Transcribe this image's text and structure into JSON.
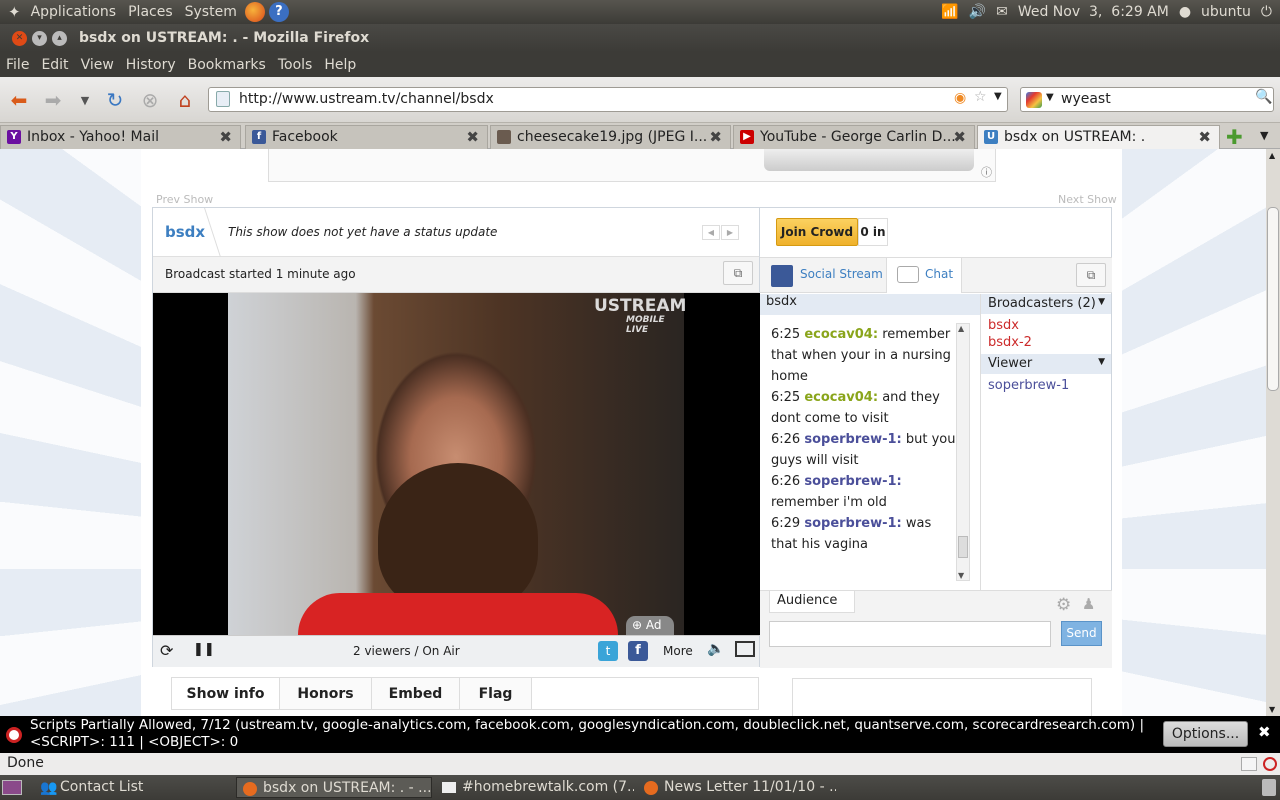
{
  "top_panel": {
    "menus": [
      "Applications",
      "Places",
      "System"
    ],
    "clock": "Wed Nov  3,  6:29 AM",
    "user": "ubuntu"
  },
  "window": {
    "title": "bsdx on USTREAM: . - Mozilla Firefox"
  },
  "menubar": [
    "File",
    "Edit",
    "View",
    "History",
    "Bookmarks",
    "Tools",
    "Help"
  ],
  "nav": {
    "url": "http://www.ustream.tv/channel/bsdx",
    "search": "wyeast"
  },
  "tabs": [
    {
      "label": "Inbox - Yahoo! Mail",
      "icon": "yahoo-icon",
      "color": "#6b0fa0",
      "glyph": "Y"
    },
    {
      "label": "Facebook",
      "icon": "facebook-icon",
      "color": "#3b5998",
      "glyph": "f"
    },
    {
      "label": "cheesecake19.jpg (JPEG I...",
      "icon": "image-icon",
      "color": "#6a5b4f",
      "glyph": ""
    },
    {
      "label": "YouTube - George Carlin D...",
      "icon": "youtube-icon",
      "color": "#cc0000",
      "glyph": "▶"
    },
    {
      "label": "bsdx on USTREAM: .",
      "icon": "ustream-icon",
      "color": "#3d7fc1",
      "glyph": "U"
    }
  ],
  "page": {
    "prev_show": "Prev Show",
    "next_show": "Next Show",
    "channel": "bsdx",
    "status": "This show does not yet have a status update",
    "join_crowd": "Join Crowd",
    "crowd_count": "0 in",
    "broadcast_started": "Broadcast started 1 minute ago",
    "social_stream": "Social Stream",
    "chat": "Chat",
    "video_logo": "USTREAM",
    "video_logo_sub": "MOBILE LIVE",
    "ad_badge": "Ad",
    "viewers": "2 viewers / On Air",
    "more": "More",
    "chat_channel": "bsdx",
    "messages": [
      {
        "time": "6:25",
        "nick": "ecocav04:",
        "text": "remember that when your in a nursing home",
        "color": "g"
      },
      {
        "time": "6:25",
        "nick": "ecocav04:",
        "text": "and they dont come to visit",
        "color": "g"
      },
      {
        "time": "6:26",
        "nick": "soperbrew-1:",
        "text": "but you guys will visit",
        "color": "b"
      },
      {
        "time": "6:26",
        "nick": "soperbrew-1:",
        "text": "remember i'm old",
        "color": "b"
      },
      {
        "time": "6:29",
        "nick": "soperbrew-1:",
        "text": "was that his vagina",
        "color": "b"
      }
    ],
    "broadcasters_header": "Broadcasters (2)",
    "broadcasters": [
      "bsdx",
      "bsdx-2"
    ],
    "viewer_header": "Viewer",
    "viewers_list": [
      "soperbrew-1"
    ],
    "audience_tab": "Audience",
    "send": "Send",
    "bottom_tabs": [
      "Show info",
      "Honors",
      "Embed",
      "Flag"
    ]
  },
  "noscript": {
    "line1": "Scripts Partially Allowed, 7/12 (ustream.tv, google-analytics.com, facebook.com, googlesyndication.com, doubleclick.net, quantserve.com, scorecardresearch.com) |",
    "line2": "<SCRIPT>: 111 | <OBJECT>: 0",
    "options": "Options..."
  },
  "statusbar": "Done",
  "taskbar": [
    "Contact List",
    "bsdx on USTREAM: . - ...",
    "#homebrewtalk.com (7...",
    "News Letter 11/01/10 - ..."
  ]
}
